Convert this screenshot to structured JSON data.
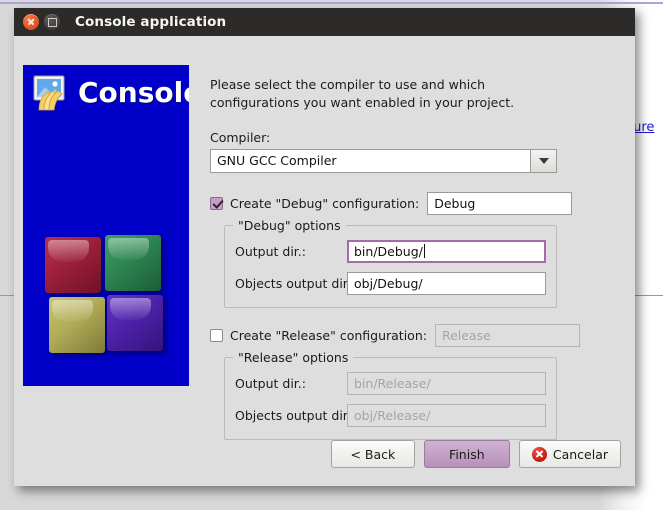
{
  "background": {
    "link_text": "ture"
  },
  "window": {
    "title": "Console application",
    "close_icon": "close-icon",
    "maximize_icon": "maximize-icon"
  },
  "banner": {
    "title": "Console",
    "icon": "picture-icon",
    "logo": "codeblocks-cubes-logo",
    "cube_colors": {
      "top_left": "#9c1f39",
      "top_right": "#2d8450",
      "bottom_left": "#b0ab56",
      "bottom_right": "#4e21a8"
    },
    "background_color": "#0000c8"
  },
  "content": {
    "intro_text": "Please select the compiler to use and which configurations you want enabled in your project.",
    "compiler_label": "Compiler:",
    "compiler_value": "GNU GCC Compiler",
    "compiler_arrow_icon": "chevron-down-icon"
  },
  "debug": {
    "checkbox_label": "Create \"Debug\" configuration:",
    "checked": true,
    "name_value": "Debug",
    "groupbox_legend": "\"Debug\" options",
    "output_dir_label": "Output dir.:",
    "output_dir_value": "bin/Debug/",
    "objects_dir_label": "Objects output dir.:",
    "objects_dir_value": "obj/Debug/"
  },
  "release": {
    "checkbox_label": "Create \"Release\" configuration:",
    "checked": false,
    "name_placeholder": "Release",
    "groupbox_legend": "\"Release\" options",
    "output_dir_label": "Output dir.:",
    "output_dir_placeholder": "bin/Release/",
    "objects_dir_label": "Objects output dir.:",
    "objects_dir_placeholder": "obj/Release/"
  },
  "buttons": {
    "back": "< Back",
    "finish": "Finish",
    "cancel": "Cancelar",
    "cancel_icon": "error-circle-icon",
    "finish_accent_color": "#b890bb"
  }
}
